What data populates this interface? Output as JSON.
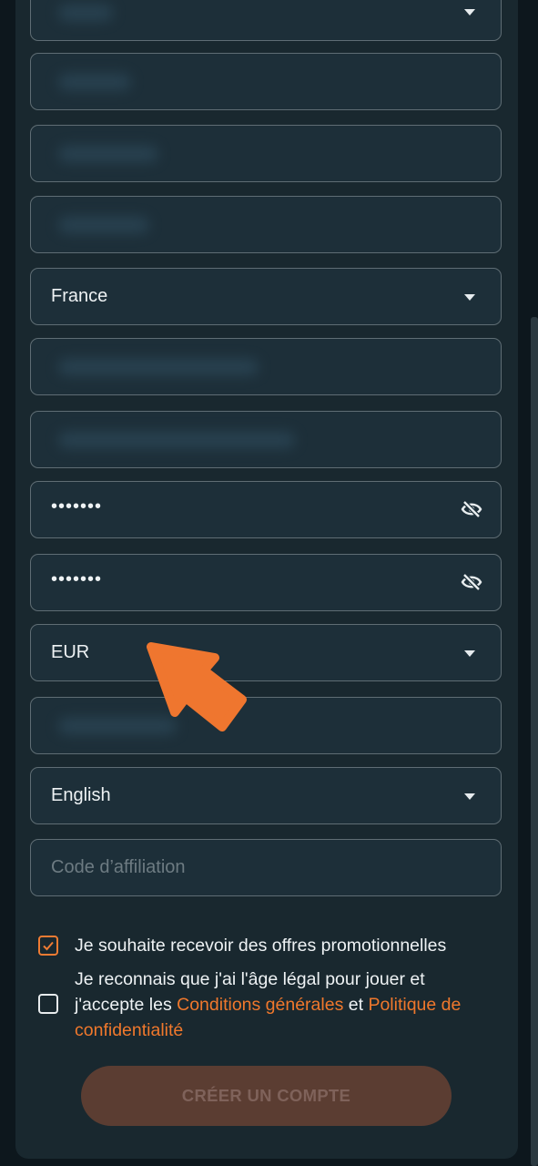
{
  "form": {
    "country": "France",
    "password": "•••••••",
    "password_confirm": "•••••••",
    "currency": "EUR",
    "language": "English",
    "affiliate_placeholder": "Code d’affiliation"
  },
  "consents": {
    "promo_label": "Je souhaite recevoir des offres promotionnelles",
    "legal_line1": "Je reconnais que j'ai l'âge légal pour jouer et",
    "legal_prefix": "j'accepte les ",
    "terms_link": "Conditions générales",
    "and": " et ",
    "privacy_link_part1": "Politique de",
    "privacy_link_part2": "confidentialité"
  },
  "submit": {
    "label": "CRÉER UN COMPTE"
  },
  "colors": {
    "accent": "#f0782c",
    "panel": "#19282f",
    "field": "#1d2f39",
    "arrow": "#ef762f"
  },
  "icons": [
    "chevron-down-icon",
    "eye-slash-icon",
    "check-icon",
    "arrow-pointer-icon"
  ]
}
